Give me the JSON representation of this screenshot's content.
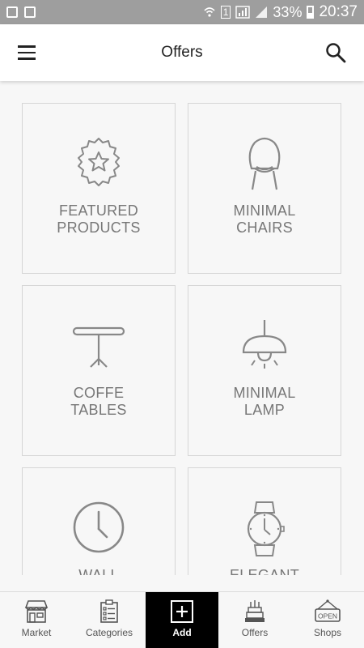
{
  "status_bar": {
    "sim_badge": "1",
    "battery": "33%",
    "time": "20:37"
  },
  "app_bar": {
    "title": "Offers"
  },
  "tiles": [
    {
      "line1": "FEATURED",
      "line2": "PRODUCTS",
      "icon": "star-badge-icon"
    },
    {
      "line1": "MINIMAL",
      "line2": "CHAIRS",
      "icon": "chair-icon"
    },
    {
      "line1": "COFFE",
      "line2": "TABLES",
      "icon": "table-icon"
    },
    {
      "line1": "MINIMAL",
      "line2": "LAMP",
      "icon": "lamp-icon"
    },
    {
      "line1": "WALL",
      "line2": "",
      "icon": "clock-icon"
    },
    {
      "line1": "ELEGANT",
      "line2": "",
      "icon": "watch-icon"
    }
  ],
  "bottom_nav": {
    "items": [
      {
        "label": "Market",
        "icon": "store-icon"
      },
      {
        "label": "Categories",
        "icon": "checklist-icon"
      },
      {
        "label": "Add",
        "icon": "add-box-icon",
        "active": true
      },
      {
        "label": "Offers",
        "icon": "cake-icon"
      },
      {
        "label": "Shops",
        "icon": "open-sign-icon"
      }
    ]
  },
  "colors": {
    "status_bar": "#9e9e9e",
    "background": "#f7f7f7",
    "active_nav": "#000000",
    "icon_stroke": "#888888"
  }
}
